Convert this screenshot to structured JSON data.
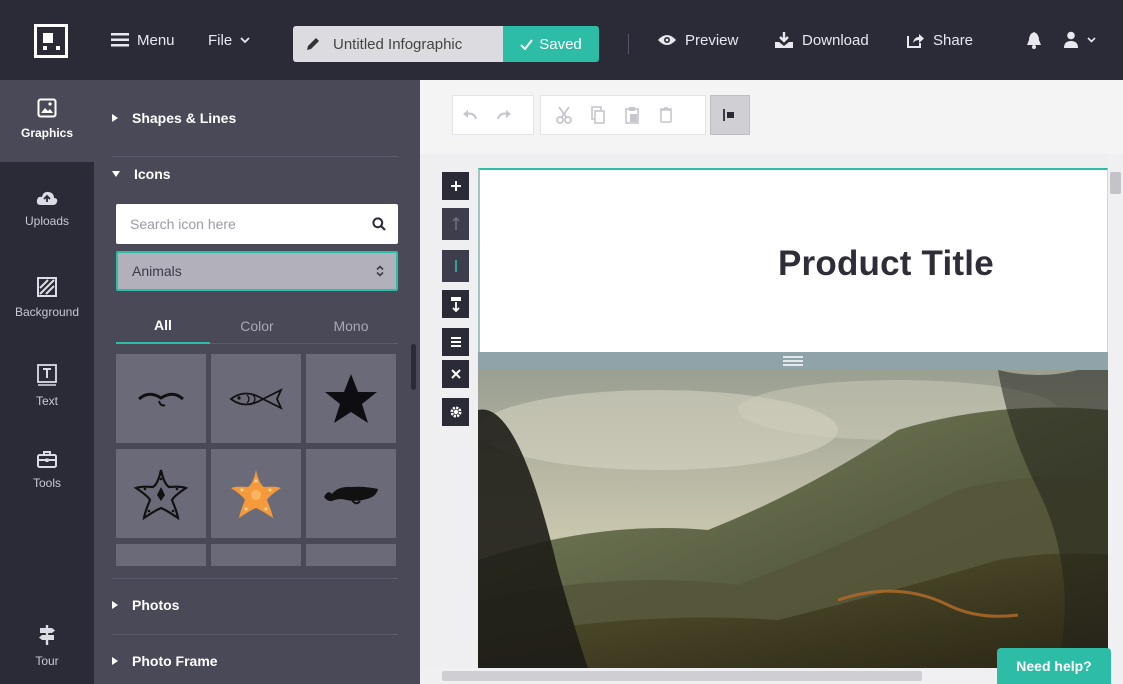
{
  "colors": {
    "topbar": "#2b2b37",
    "panel": "#4a4958",
    "accent": "#2dbda6",
    "canvas": "#ffffff",
    "title_text": "#2e2e38"
  },
  "topbar": {
    "menu_label": "Menu",
    "file_label": "File",
    "doc_title": "Untitled Infographic",
    "saved_label": "Saved",
    "preview_label": "Preview",
    "download_label": "Download",
    "share_label": "Share"
  },
  "rail": {
    "items": [
      {
        "label": "Graphics",
        "icon": "image-icon"
      },
      {
        "label": "Uploads",
        "icon": "cloud-upload-icon"
      },
      {
        "label": "Background",
        "icon": "hatched-square-icon"
      },
      {
        "label": "Text",
        "icon": "text-box-icon"
      },
      {
        "label": "Tools",
        "icon": "toolbox-icon"
      },
      {
        "label": "Tour",
        "icon": "signpost-icon"
      }
    ]
  },
  "panel": {
    "sections": {
      "shapes": "Shapes & Lines",
      "icons": "Icons",
      "photos": "Photos",
      "photo_frame": "Photo Frame"
    },
    "search_placeholder": "Search icon here",
    "category_selected": "Animals",
    "tabs": [
      "All",
      "Color",
      "Mono"
    ],
    "icons": [
      "bird-icon",
      "fish-icon",
      "star-icon",
      "starfish-outline-icon",
      "starfish-color-icon",
      "whale-icon"
    ]
  },
  "toolbar": {
    "tools": [
      "undo-icon",
      "redo-icon",
      "cut-icon",
      "copy-icon",
      "paste-icon",
      "delete-icon",
      "align-icon"
    ]
  },
  "canvas": {
    "product_title": "Product Title"
  },
  "help": {
    "label": "Need help?"
  }
}
